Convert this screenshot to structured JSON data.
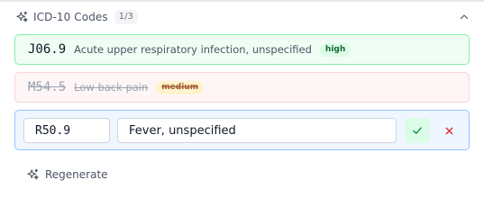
{
  "header": {
    "title": "ICD-10 Codes",
    "count": "1/3",
    "icon": "sparkles-icon",
    "collapse_icon": "chevron-up-icon"
  },
  "codes": [
    {
      "code": "J06.9",
      "description": "Acute upper respiratory infection, unspecified",
      "confidence": "high",
      "status": "accepted"
    },
    {
      "code": "M54.5",
      "description": "Low back pain",
      "confidence": "medium",
      "status": "rejected"
    }
  ],
  "editing": {
    "code_value": "R50.9",
    "description_value": "Fever, unspecified",
    "save_icon": "check-icon",
    "cancel_icon": "x-icon"
  },
  "footer": {
    "regenerate_label": "Regenerate",
    "icon": "sparkles-icon"
  },
  "colors": {
    "accepted_border": "#86efac",
    "accepted_bg": "#f0fdf4",
    "rejected_border": "#fbd5d5",
    "editing_border": "#93c5fd",
    "editing_bg": "#eff6ff",
    "check_green": "#16a34a",
    "cancel_red": "#dc2626"
  }
}
